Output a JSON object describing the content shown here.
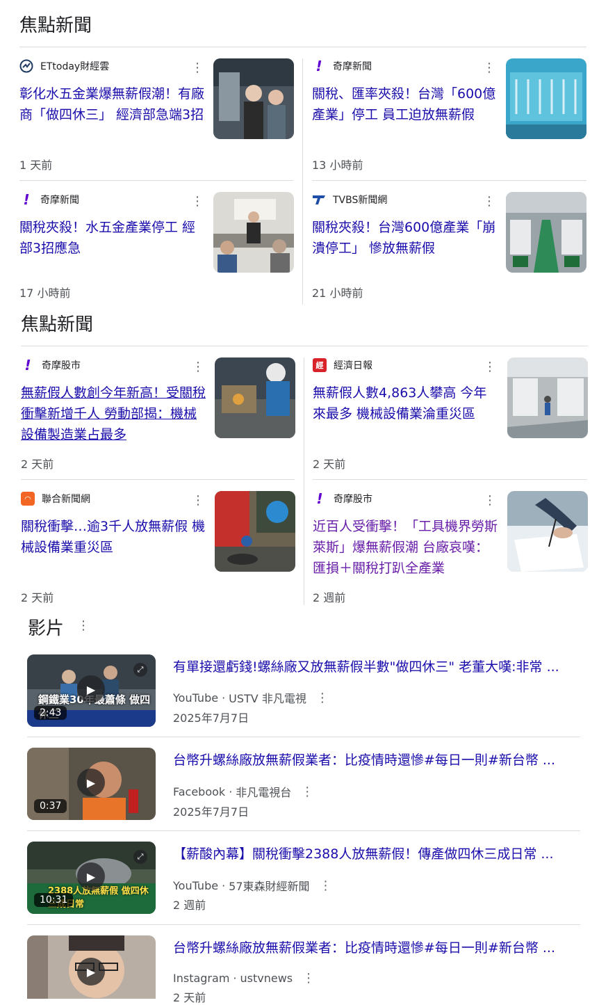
{
  "sections": {
    "top_stories_1_title": "焦點新聞",
    "top_stories_2_title": "焦點新聞",
    "videos_title": "影片"
  },
  "news_group_1": [
    {
      "source": "ETtoday財經雲",
      "headline": "彰化水五金業爆無薪假潮！有廠商「做四休三」 經濟部急端3招",
      "time": "1 天前"
    },
    {
      "source": "奇摩新聞",
      "headline": "關稅、匯率夾殺！台灣「600億產業」停工 員工迫放無薪假",
      "time": "13 小時前"
    },
    {
      "source": "奇摩新聞",
      "headline": "關稅夾殺！水五金產業停工 經部3招應急",
      "time": "17 小時前"
    },
    {
      "source": "TVBS新聞網",
      "headline": "關稅夾殺！台灣600億產業「崩潰停工」 慘放無薪假",
      "time": "21 小時前"
    }
  ],
  "news_group_2": [
    {
      "source": "奇摩股市",
      "headline": "無薪假人數創今年新高！受關稅衝擊新增千人 勞動部揭：機械設備製造業占最多",
      "time": "2 天前"
    },
    {
      "source": "經濟日報",
      "headline": "無薪假人數4,863人攀高 今年來最多 機械設備業淪重災區",
      "time": "2 天前"
    },
    {
      "source": "聯合新聞網",
      "headline": "關稅衝擊…逾3千人放無薪假 機械設備業重災區",
      "time": "2 天前"
    },
    {
      "source": "奇摩股市",
      "headline": "近百人受衝擊！「工具機界勞斯萊斯」爆無薪假潮 台廠哀嘆：匯損＋關稅打趴全產業",
      "time": "2 週前"
    }
  ],
  "videos": [
    {
      "title": "有單接還虧錢!螺絲廠又放無薪假半數\"做四休三\" 老董大嘆:非常 ...",
      "platform": "YouTube",
      "channel": "USTV 非凡電視",
      "date": "2025年7月7日",
      "duration": "2:43",
      "overlay": "鋼鐵業30年最蕭條 做四休三"
    },
    {
      "title": "台幣升螺絲廠放無薪假業者：比疫情時還慘#每日一則#新台幣 ...",
      "platform": "Facebook",
      "channel": "非凡電視台",
      "date": "2025年7月7日",
      "duration": "0:37",
      "overlay": ""
    },
    {
      "title": "【薪酸內幕】關稅衝擊2388人放無薪假！傳產做四休三成日常 ...",
      "platform": "YouTube",
      "channel": "57東森財經新聞",
      "date": "2 週前",
      "duration": "10:31",
      "overlay": "2388人放無薪假 做四休三成日常"
    },
    {
      "title": "台幣升螺絲廠放無薪假業者：比疫情時還慘#每日一則#新台幣 ...",
      "platform": "Instagram",
      "channel": "ustvnews",
      "date": "2 天前",
      "duration": "",
      "overlay": ""
    }
  ],
  "colors": {
    "link": "#1a0dab",
    "visited": "#681da8",
    "yahoo": "#6001d2",
    "tvbs": "#1e4ea8",
    "udn_bg": "#f26522",
    "edn_bg": "#d8232a"
  },
  "icons": {
    "more": "more-vert-icon",
    "play": "play-icon",
    "expand": "expand-icon"
  }
}
